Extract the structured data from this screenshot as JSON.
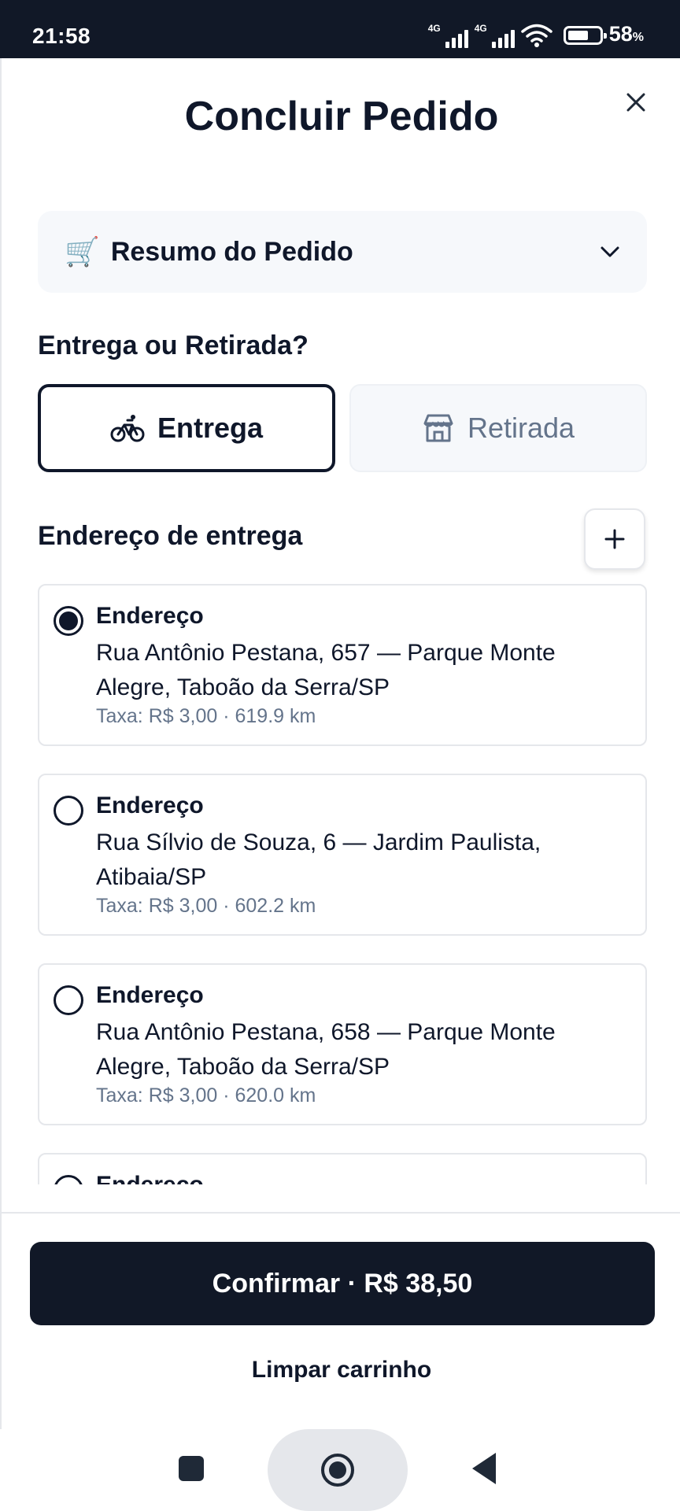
{
  "status_bar": {
    "time": "21:58",
    "network_1": "4G",
    "network_2": "4G",
    "battery_percent": "58",
    "battery_unit": "%",
    "icons": [
      "signal-icon",
      "signal-icon",
      "wifi-icon",
      "battery-icon"
    ]
  },
  "header": {
    "title": "Concluir Pedido",
    "close_icon": "close-icon"
  },
  "summary": {
    "icon": "🛒",
    "label": "Resumo do Pedido",
    "chevron_icon": "chevron-down-icon"
  },
  "delivery_mode": {
    "question": "Entrega ou Retirada?",
    "options": [
      {
        "label": "Entrega",
        "icon": "bicycle-icon",
        "selected": true
      },
      {
        "label": "Retirada",
        "icon": "store-icon",
        "selected": false
      }
    ]
  },
  "address_section": {
    "title": "Endereço de entrega",
    "add_icon": "plus-icon",
    "addresses": [
      {
        "title": "Endereço",
        "line": "Rua Antônio Pestana, 657 — Parque Monte Alegre, Taboão da Serra/SP",
        "fee": "Taxa: R$ 3,00 · 619.9 km",
        "selected": true
      },
      {
        "title": "Endereço",
        "line": "Rua Sílvio de Souza, 6 — Jardim Paulista, Atibaia/SP",
        "fee": "Taxa: R$ 3,00 · 602.2 km",
        "selected": false
      },
      {
        "title": "Endereço",
        "line": "Rua Antônio Pestana, 658 — Parque Monte Alegre, Taboão da Serra/SP",
        "fee": "Taxa: R$ 3,00 · 620.0 km",
        "selected": false
      },
      {
        "title": "Endereço",
        "line": "",
        "fee": "",
        "selected": false
      }
    ]
  },
  "footer": {
    "confirm_label": "Confirmar · R$ 38,50",
    "clear_label": "Limpar carrinho"
  },
  "colors": {
    "primary": "#111827",
    "muted_text": "#64748b",
    "card_border": "#e5e7eb",
    "soft_bg": "#f6f8fb"
  }
}
